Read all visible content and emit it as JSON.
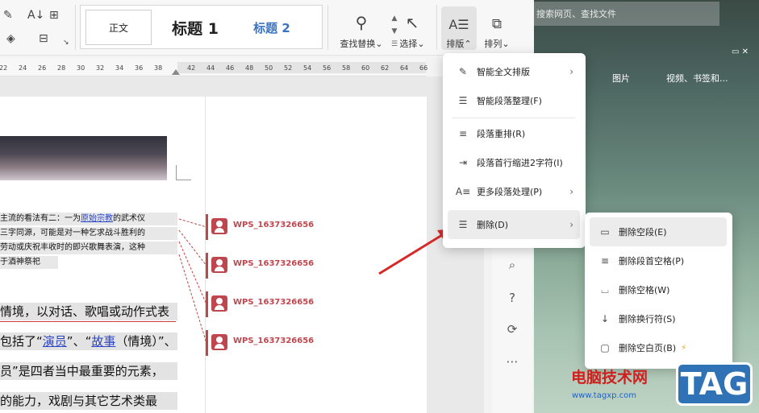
{
  "ribbon": {
    "styles": {
      "normal": "正文",
      "heading1": "标题 1",
      "heading2": "标题 2"
    },
    "find_replace": "查找替换",
    "select": "选择",
    "typeset": "排版",
    "arrange": "排列",
    "dropdown_glyph": "⌄"
  },
  "ruler": {
    "ticks": [
      "22",
      "24",
      "26",
      "28",
      "30",
      "32",
      "34",
      "36",
      "38",
      "42",
      "44",
      "46",
      "48",
      "50",
      "52",
      "54",
      "56",
      "58",
      "60",
      "62",
      "64",
      "66"
    ]
  },
  "document": {
    "small_lines": [
      [
        "主流的看法有二：一为",
        "原始宗教",
        "的武术仪"
      ],
      [
        "三字同源，可能是对一种乞求战斗胜利的",
        "",
        ""
      ],
      [
        "劳动或庆祝丰收时的即兴歌舞表演，这种",
        "",
        ""
      ],
      [
        "于酒神祭祀",
        "",
        ""
      ]
    ],
    "big_lines": [
      [
        "情境，以对话、歌唱或动作式表",
        "",
        ""
      ],
      [
        "包括了“",
        "演员",
        "”、“"
      ],
      [
        "员”是四者当中最重要的元素，",
        "",
        ""
      ],
      [
        "的能力，戏剧与其它艺术类最",
        "",
        ""
      ]
    ],
    "big_line2_rest": [
      "故事",
      "（情境）”、"
    ]
  },
  "comments": [
    "WPS_1637326656",
    "WPS_1637326656",
    "WPS_1637326656",
    "WPS_1637326656"
  ],
  "browser": {
    "search_placeholder": "搜索网页、查找文件",
    "tabs": [
      "图片",
      "视频、书签和..."
    ]
  },
  "typeset_menu": [
    {
      "label": "智能全文排版",
      "icon": "smart-typeset-icon",
      "submenu": true
    },
    {
      "label": "智能段落整理(F)",
      "icon": "paragraph-clean-icon",
      "submenu": false
    },
    {
      "label": "段落重排(R)",
      "icon": "paragraph-reflow-icon",
      "submenu": false
    },
    {
      "label": "段落首行缩进2字符(I)",
      "icon": "indent-icon",
      "submenu": false
    },
    {
      "label": "更多段落处理(P)",
      "icon": "more-paragraph-icon",
      "submenu": true
    },
    {
      "label": "删除(D)",
      "icon": "delete-lines-icon",
      "submenu": true
    }
  ],
  "delete_menu": [
    {
      "label": "删除空段(E)",
      "icon": "delete-empty-paragraph-icon"
    },
    {
      "label": "删除段首空格(P)",
      "icon": "delete-leading-space-icon"
    },
    {
      "label": "删除空格(W)",
      "icon": "delete-space-icon"
    },
    {
      "label": "删除换行符(S)",
      "icon": "delete-line-break-icon"
    },
    {
      "label": "删除空白页(B)",
      "icon": "delete-blank-page-icon"
    }
  ],
  "watermark": {
    "site_name": "电脑技术网",
    "url": "www.tagxp.com",
    "tag": "TAG"
  },
  "colors": {
    "accent_red": "#c0464d",
    "arrow_red": "#d42a2a",
    "link_blue": "#2a44c4",
    "heading2_blue": "#3b73c4"
  }
}
